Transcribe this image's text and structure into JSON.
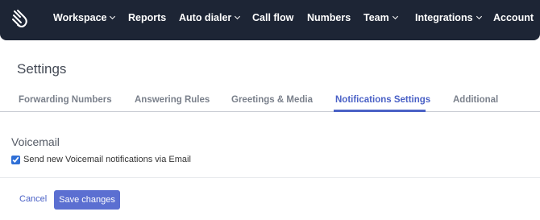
{
  "topbar": {
    "logo_icon": "hand-logo-icon",
    "nav": [
      {
        "label": "Workspace",
        "dropdown": true
      },
      {
        "label": "Reports",
        "dropdown": false
      },
      {
        "label": "Auto dialer",
        "dropdown": true
      },
      {
        "label": "Call flow",
        "dropdown": false
      },
      {
        "label": "Numbers",
        "dropdown": false
      },
      {
        "label": "Team",
        "dropdown": true
      },
      {
        "label": "Integrations",
        "dropdown": true
      },
      {
        "label": "Account",
        "dropdown": false
      }
    ]
  },
  "page": {
    "title": "Settings",
    "tabs": [
      {
        "label": "Forwarding Numbers",
        "active": false
      },
      {
        "label": "Answering Rules",
        "active": false
      },
      {
        "label": "Greetings & Media",
        "active": false
      },
      {
        "label": "Notifications Settings",
        "active": true
      },
      {
        "label": "Additional",
        "active": false
      }
    ]
  },
  "voicemail": {
    "title": "Voicemail",
    "checkbox_label": "Send new Voicemail notifications via Email",
    "checked": true
  },
  "actions": {
    "cancel_label": "Cancel",
    "save_label": "Save changes"
  },
  "colors": {
    "nav_bg": "#1d2535",
    "accent": "#4a61c6",
    "save_button": "#5b6fd1"
  }
}
